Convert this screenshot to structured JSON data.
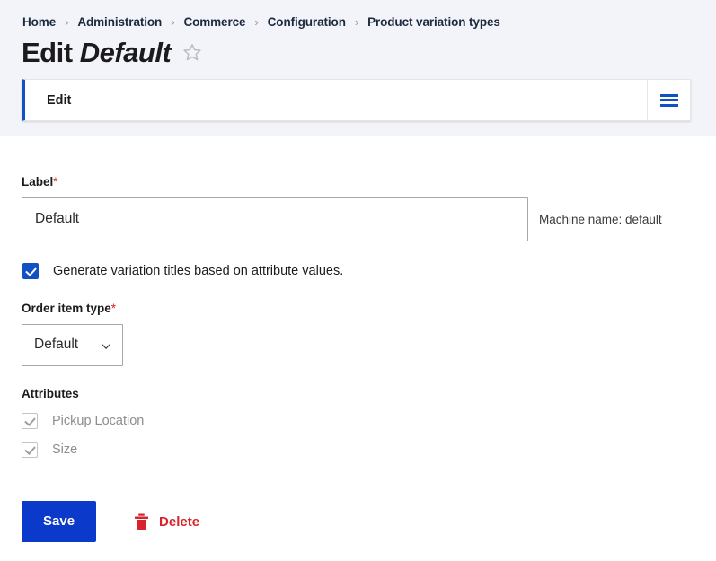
{
  "breadcrumb": {
    "separator": "›",
    "items": [
      {
        "label": "Home"
      },
      {
        "label": "Administration"
      },
      {
        "label": "Commerce"
      },
      {
        "label": "Configuration"
      },
      {
        "label": "Product variation types"
      }
    ]
  },
  "header": {
    "title_prefix": "Edit",
    "title_entity": "Default",
    "star_icon": "star-outline-icon"
  },
  "tabs": {
    "items": [
      {
        "label": "Edit"
      }
    ],
    "toggle_icon": "hamburger-icon"
  },
  "form": {
    "label_field": {
      "label": "Label",
      "required_mark": "*",
      "value": "Default",
      "placeholder": "",
      "machine_name": "Machine name: default"
    },
    "generate_titles": {
      "label": "Generate variation titles based on attribute values.",
      "checked": true
    },
    "order_item_type": {
      "label": "Order item type",
      "required_mark": "*",
      "selected": "Default",
      "chevron_icon": "chevron-down-icon"
    },
    "attributes": {
      "title": "Attributes",
      "items": [
        {
          "label": "Pickup Location",
          "checked": true,
          "disabled": true
        },
        {
          "label": "Size",
          "checked": true,
          "disabled": true
        }
      ]
    }
  },
  "actions": {
    "save_label": "Save",
    "delete_label": "Delete",
    "delete_icon": "trash-icon"
  },
  "colors": {
    "accent_blue": "#1251c4",
    "button_blue": "#0b39c9",
    "danger_red": "#d7232b",
    "required_red": "#d72222",
    "page_gray": "#f3f4f9",
    "text_dark": "#1b1b1d",
    "muted_gray": "#8d8d93"
  }
}
